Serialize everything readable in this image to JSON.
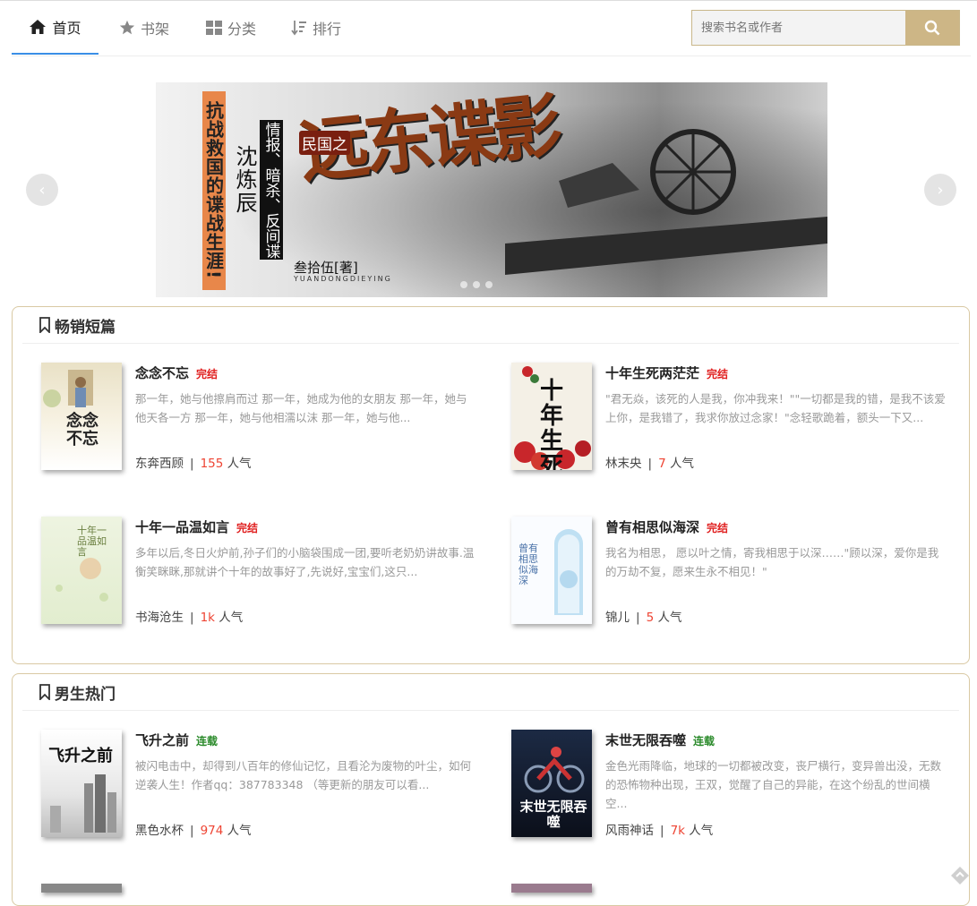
{
  "nav": {
    "items": [
      {
        "label": "首页",
        "icon": "home-icon"
      },
      {
        "label": "书架",
        "icon": "star-icon"
      },
      {
        "label": "分类",
        "icon": "grid-icon"
      },
      {
        "label": "排行",
        "icon": "sort-icon"
      }
    ],
    "active": 0,
    "search_placeholder": "搜索书名或作者",
    "accent": "#3a8ee6",
    "search_button_color": "#cdb686"
  },
  "banner": {
    "side_text": "抗战救国的谍战生涯!",
    "author": "沈炼辰",
    "tag": "情报、暗杀、反间谍",
    "prefix": "民国之",
    "title": "远东谍影",
    "writer": "叁拾伍[著]",
    "pinyin": "YUANDONGDIEYING"
  },
  "sections": [
    {
      "title": "畅销短篇",
      "books": [
        {
          "name": "念念不忘",
          "status": "完结",
          "desc": "那一年，她与他擦肩而过 那一年，她成为他的女朋友 那一年，她与他天各一方 那一年，她与他相濡以沫 那一年，她与他...",
          "author": "东奔西顾",
          "popularity": "155",
          "pop_unit": "人气",
          "cover_text": "念念不忘"
        },
        {
          "name": "十年生死两茫茫",
          "status": "完结",
          "desc": "\"君无焱，该死的人是我，你冲我来！\"\"一切都是我的错，是我不该爱上你，是我错了，我求你放过念家！\"念轻歌跪着，额头一下又...",
          "author": "林末央",
          "popularity": "7",
          "pop_unit": "人气",
          "cover_text": "十年生死"
        },
        {
          "name": "十年一品温如言",
          "status": "完结",
          "desc": "多年以后,冬日火炉前,孙子们的小脑袋围成一团,要听老奶奶讲故事.温衡笑眯眯,那就讲个十年的故事好了,先说好,宝宝们,这只...",
          "author": "书海沧生",
          "popularity": "1k",
          "pop_unit": "人气",
          "cover_text": "十年一品温如言"
        },
        {
          "name": "曾有相思似海深",
          "status": "完结",
          "desc": "我名为相思， 愿以叶之情，寄我相思于以深……\"顾以深，爱你是我的万劫不复，愿来生永不相见！\"",
          "author": "锦儿",
          "popularity": "5",
          "pop_unit": "人气",
          "cover_text": "曾有相思似海深"
        }
      ]
    },
    {
      "title": "男生热门",
      "books": [
        {
          "name": "飞升之前",
          "status": "连载",
          "desc": "被闪电击中，却得到八百年的修仙记忆，且看沦为废物的叶尘，如何逆袭人生！作者qq：387783348 （等更新的朋友可以看...",
          "author": "黑色水杯",
          "popularity": "974",
          "pop_unit": "人气",
          "cover_text": "飞升之前"
        },
        {
          "name": "末世无限吞噬",
          "status": "连载",
          "desc": "金色光雨降临，地球的一切都被改变，丧尸横行，变异兽出没，无数的恐怖物种出现，王双，觉醒了自己的异能，在这个纷乱的世间横空...",
          "author": "风雨神话",
          "popularity": "7k",
          "pop_unit": "人气",
          "cover_text": "末世无限吞噬"
        }
      ]
    }
  ],
  "status_colors": {
    "完结": "#e02020",
    "连载": "#2a8a2a"
  }
}
